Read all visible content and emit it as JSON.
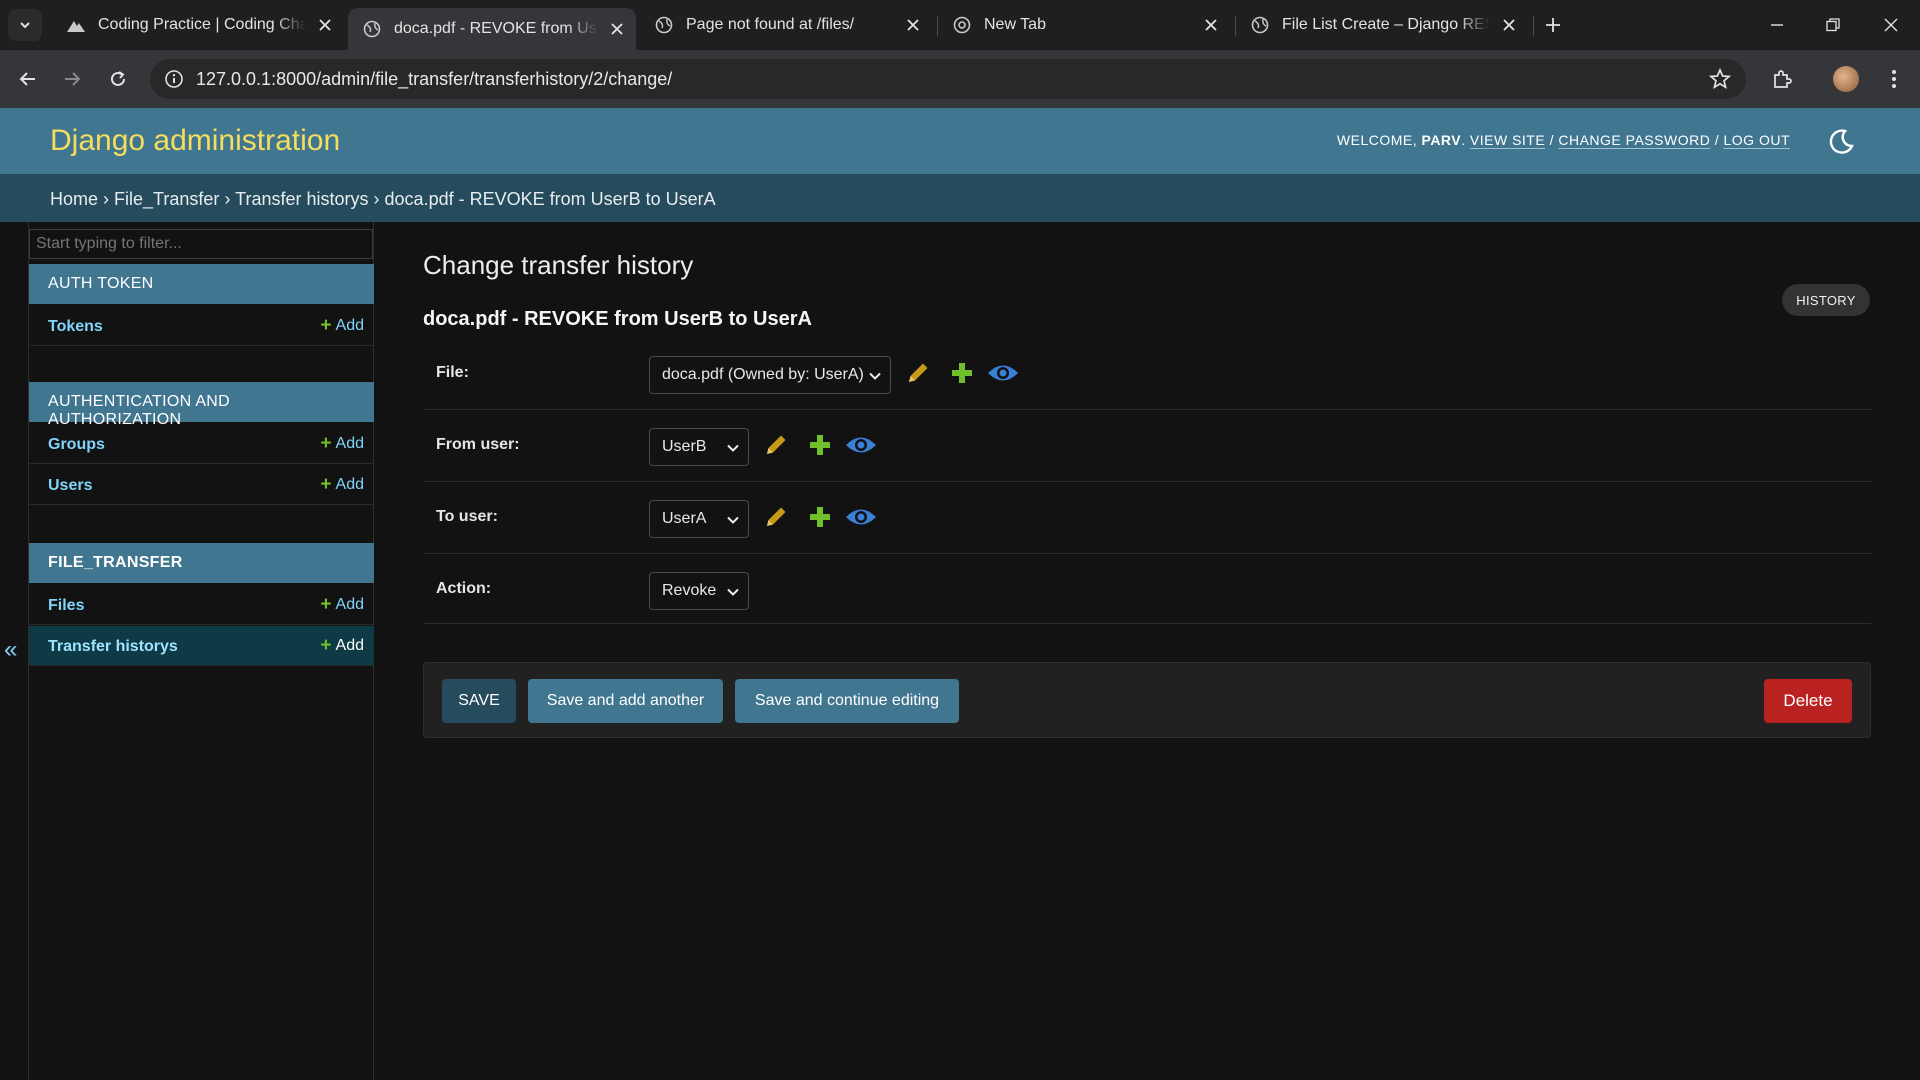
{
  "browser": {
    "tabs": [
      {
        "title": "Coding Practice | Coding Challe",
        "icon": "mountain-icon"
      },
      {
        "title": "doca.pdf - REVOKE from UserB",
        "icon": "globe-icon"
      },
      {
        "title": "Page not found at /files/",
        "icon": "globe-icon"
      },
      {
        "title": "New Tab",
        "icon": "chrome-icon"
      },
      {
        "title": "File List Create – Django REST fr",
        "icon": "globe-icon"
      }
    ],
    "url": "127.0.0.1:8000/admin/file_transfer/transferhistory/2/change/"
  },
  "header": {
    "branding": "Django administration",
    "welcome": "Welcome,",
    "username": "parv",
    "view_site": "View site",
    "change_password": "Change password",
    "log_out": "Log out",
    "separator": "/"
  },
  "breadcrumbs": {
    "home": "Home",
    "app": "File_Transfer",
    "model": "Transfer historys",
    "object": "doca.pdf - REVOKE from UserB to UserA",
    "sep": "›"
  },
  "sidebar": {
    "filter_placeholder": "Start typing to filter...",
    "add_label": "Add",
    "modules": [
      {
        "caption": "AUTH TOKEN",
        "models": [
          "Tokens"
        ]
      },
      {
        "caption": "AUTHENTICATION AND AUTHORIZATION",
        "models": [
          "Groups",
          "Users"
        ]
      },
      {
        "caption": "FILE_TRANSFER",
        "models": [
          "Files",
          "Transfer historys"
        ]
      }
    ]
  },
  "content": {
    "title": "Change transfer history",
    "history_label": "HISTORY",
    "object_heading": "doca.pdf - REVOKE from UserB to UserA",
    "fields": [
      {
        "label": "File:",
        "value": "doca.pdf (Owned by: UserA)"
      },
      {
        "label": "From user:",
        "value": "UserB"
      },
      {
        "label": "To user:",
        "value": "UserA"
      },
      {
        "label": "Action:",
        "value": "Revoke"
      }
    ],
    "buttons": {
      "save": "SAVE",
      "save_add_another": "Save and add another",
      "save_continue": "Save and continue editing",
      "delete": "Delete"
    }
  },
  "colors": {
    "header": "#417690",
    "breadcrumbs": "#264b5d",
    "branding": "#f5dd5d",
    "link": "#81d4fa",
    "add_plus": "#70bf2b",
    "delete": "#ba2121",
    "edit_pencil": "#c99a1a",
    "view_eye": "#3a7fd6"
  }
}
